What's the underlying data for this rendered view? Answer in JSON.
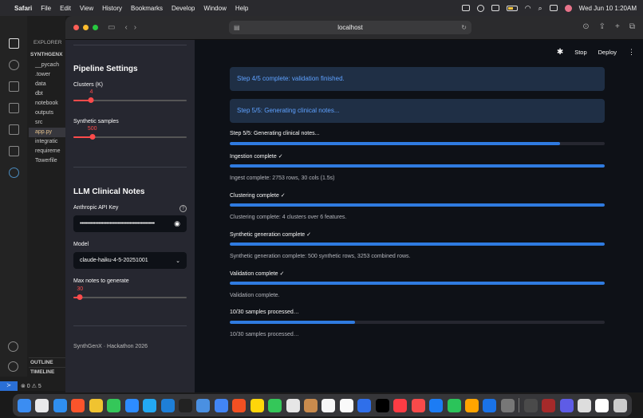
{
  "menubar": {
    "app_name": "Safari",
    "menus": [
      "File",
      "Edit",
      "View",
      "History",
      "Bookmarks",
      "Develop",
      "Window",
      "Help"
    ],
    "datetime": "Wed Jun 10  1:20AM"
  },
  "vscode": {
    "explorer_header": "EXPLORER",
    "root": "SYNTHGENX",
    "items": [
      "__pycach",
      ".tower",
      "data",
      "dbt",
      "notebook",
      "outputs",
      "src",
      "app.py",
      "integratic",
      "requireme",
      "Towerfile"
    ],
    "selected_index": 7,
    "outline_label": "OUTLINE",
    "timeline_label": "TIMELINE",
    "status_counts": "⊗ 0 ⚠ 5"
  },
  "browser": {
    "url": "localhost"
  },
  "sidebar": {
    "pipeline_title": "Pipeline Settings",
    "clusters_label": "Clusters (K)",
    "clusters_value": "4",
    "clusters_min": 1,
    "clusters_max": 20,
    "synthetic_label": "Synthetic samples",
    "synthetic_value": "500",
    "synthetic_min": 0,
    "synthetic_max": 3000,
    "llm_title": "LLM Clinical Notes",
    "api_key_label": "Anthropic API Key",
    "api_key_masked": "••••••••••••••••••••••••••••••••••••••••••••••••",
    "model_label": "Model",
    "model_value": "claude-haiku-4-5-20251001",
    "max_notes_label": "Max notes to generate",
    "max_notes_value": "30",
    "max_notes_min": 1,
    "max_notes_max": 500,
    "footer": "SynthGenX · Hackathon 2026"
  },
  "main": {
    "stop_label": "Stop",
    "deploy_label": "Deploy",
    "info_boxes": [
      "Step 4/5 complete: validation finished.",
      "Step 5/5: Generating clinical notes..."
    ],
    "progress_items": [
      {
        "label": "Step 5/5: Generating clinical notes...",
        "progress": 0.88,
        "caption": ""
      },
      {
        "label": "Ingestion complete ✓",
        "progress": 1.0,
        "caption": "Ingest complete: 2753 rows, 30 cols (1.5s)"
      },
      {
        "label": "Clustering complete ✓",
        "progress": 1.0,
        "caption": "Clustering complete: 4 clusters over 6 features."
      },
      {
        "label": "Synthetic generation complete ✓",
        "progress": 1.0,
        "caption": "Synthetic generation complete: 500 synthetic rows, 3253 combined rows."
      },
      {
        "label": "Validation complete ✓",
        "progress": 1.0,
        "caption": "Validation complete."
      },
      {
        "label": "10/30 samples processed…",
        "progress": 0.333,
        "caption": "10/30 samples processed…"
      }
    ]
  },
  "dock": {
    "colors": [
      "#3b8df2",
      "#e9e9ea",
      "#2f8ff0",
      "#fb542b",
      "#f0c330",
      "#34c759",
      "#2d8cff",
      "#23a9f2",
      "#1e7fd8",
      "#222222",
      "#4a90e2",
      "#4285f4",
      "#f25022",
      "#ffd60a",
      "#34c759",
      "#e6e6e6",
      "#c98b4d",
      "#f7f7f7",
      "#fafafa",
      "#2f6fea",
      "#000000",
      "#fc3c44",
      "#f84a4a",
      "#1c7cf4",
      "#2bc45a",
      "#ffa500",
      "#1a73e8",
      "#777777",
      "#4a4a4a",
      "#a52a2a",
      "#5e5ce6",
      "#dddddd",
      "#ffffff",
      "#cccccc"
    ]
  }
}
